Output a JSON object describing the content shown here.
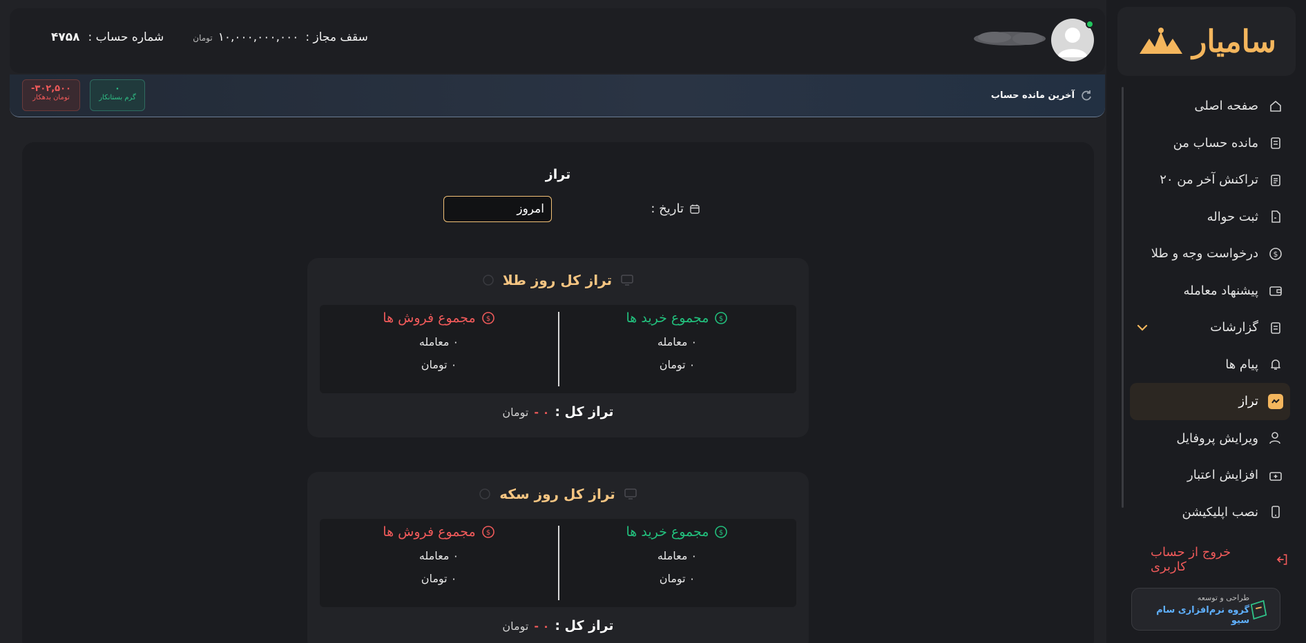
{
  "brand": {
    "name": "سامیار"
  },
  "sidebar": {
    "items": [
      {
        "label": "صفحه اصلی",
        "icon": "home-icon"
      },
      {
        "label": "مانده حساب من",
        "icon": "clipboard-icon"
      },
      {
        "label": "۲۰ تراکنش آخر من",
        "icon": "clipboard-list-icon"
      },
      {
        "label": "ثبت حواله",
        "icon": "document-icon"
      },
      {
        "label": "درخواست وجه و طلا",
        "icon": "dollar-circle-icon"
      },
      {
        "label": "پیشنهاد معامله",
        "icon": "wallet-icon"
      },
      {
        "label": "گزارشات",
        "icon": "report-icon"
      },
      {
        "label": "پیام ها",
        "icon": "bell-icon"
      },
      {
        "label": "تراز",
        "icon": "chart-icon",
        "active": true
      },
      {
        "label": "ویرایش پروفایل",
        "icon": "user-edit-icon"
      },
      {
        "label": "افزایش اعتبار",
        "icon": "wallet-plus-icon"
      },
      {
        "label": "نصب اپلیکیشن",
        "icon": "mobile-icon"
      }
    ],
    "logout_label": "خروج از حساب کاربری",
    "credit": {
      "small": "طراحی و توسعه",
      "big": "گروه نرم‌افزاری سام سیو"
    }
  },
  "header": {
    "account_label": "شماره حساب :",
    "account_number": "۴۷۵۸",
    "limit_label": "سقف مجاز :",
    "limit_value": "۱۰,۰۰۰,۰۰۰,۰۰۰",
    "limit_unit": "تومان"
  },
  "balance": {
    "title": "آخرین مانده حساب",
    "chips": [
      {
        "value": "۰",
        "label": "گرم بستانکار",
        "color": "#2fbf86"
      },
      {
        "value": "-۳۰۲,۵۰۰",
        "label": "تومان بدهکار",
        "color": "#f05a5a"
      }
    ]
  },
  "page": {
    "title": "تراز",
    "date_label": "تاریخ :",
    "date_value": "امروز"
  },
  "cards": [
    {
      "title": "تراز کل روز طلا",
      "buy_title": "مجموع خرید ها",
      "sell_title": "مجموع فروش ها",
      "buy_count": "۰ معامله",
      "buy_amount": "۰ تومان",
      "sell_count": "۰ معامله",
      "sell_amount": "۰ تومان",
      "total_label": "تراز کل :",
      "total_value": "۰ -",
      "total_unit": "تومان"
    },
    {
      "title": "تراز کل روز سکه",
      "buy_title": "مجموع خرید ها",
      "sell_title": "مجموع فروش ها",
      "buy_count": "۰ معامله",
      "buy_amount": "۰ تومان",
      "sell_count": "۰ معامله",
      "sell_amount": "۰ تومان",
      "total_label": "تراز کل :",
      "total_value": "۰ -",
      "total_unit": "تومان"
    }
  ]
}
